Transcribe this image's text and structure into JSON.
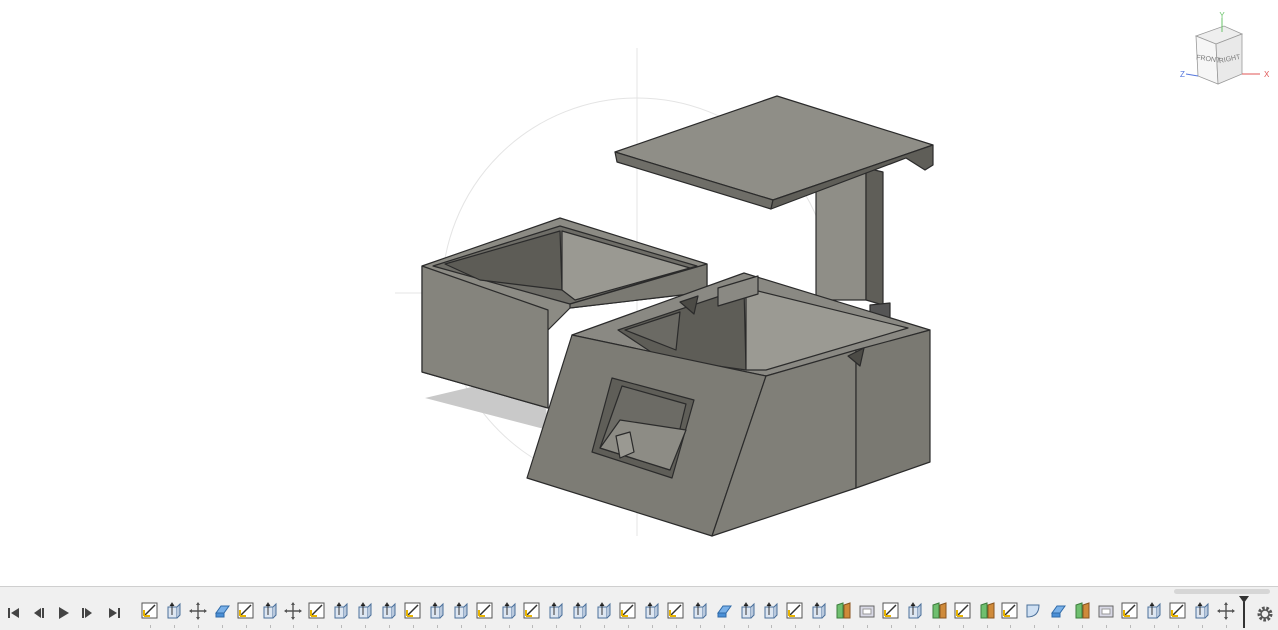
{
  "viewcube": {
    "front_label": "FRONT",
    "right_label": "RIGHT",
    "axis_y": "Y",
    "axis_x": "X",
    "axis_z": "Z"
  },
  "timeline": {
    "controls": [
      "go-to-start",
      "step-back",
      "play",
      "step-forward",
      "go-to-end"
    ],
    "features": [
      "sketch",
      "extrude",
      "move",
      "body",
      "sketch",
      "extrude",
      "move",
      "sketch",
      "extrude",
      "extrude",
      "extrude",
      "sketch",
      "extrude",
      "extrude",
      "sketch",
      "extrude",
      "sketch",
      "extrude",
      "extrude",
      "extrude",
      "sketch",
      "extrude",
      "sketch",
      "extrude",
      "body",
      "extrude",
      "extrude",
      "sketch",
      "extrude",
      "split",
      "shell",
      "sketch",
      "extrude",
      "split",
      "sketch",
      "split",
      "sketch",
      "fillet",
      "body",
      "split",
      "shell",
      "sketch",
      "extrude",
      "sketch",
      "extrude",
      "move"
    ]
  },
  "colors": {
    "model_face_light": "#8e8d86",
    "model_face_mid": "#7b7a73",
    "model_face_dark": "#5c5b55",
    "edge": "#2b2b2b",
    "sketch_icon": "#e8b400",
    "body_icon": "#4a8fd6"
  }
}
